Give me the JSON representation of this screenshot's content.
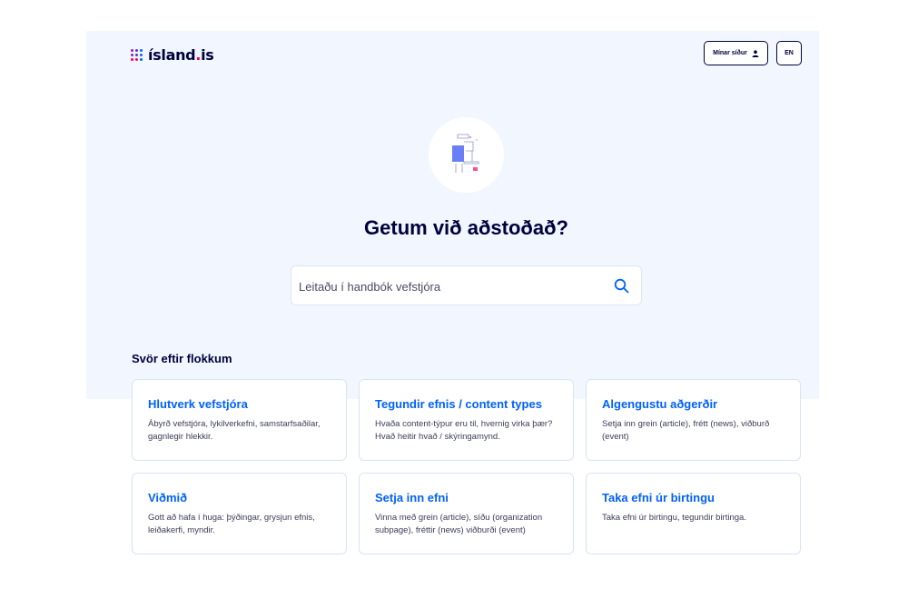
{
  "header": {
    "logo_text": "ísland",
    "logo_suffix": "is",
    "my_pages_label": "Mínar síður",
    "lang_label": "EN"
  },
  "hero": {
    "title": "Getum við aðstoðað?",
    "search_placeholder": "Leitaðu í handbók vefstjóra"
  },
  "categories": {
    "heading": "Svör eftir flokkum",
    "cards": [
      {
        "title": "Hlutverk vefstjóra",
        "desc": "Ábyrð vefstjóra, lykilverkefni, samstarfsaðilar, gagnlegir hlekkir."
      },
      {
        "title": "Tegundir efnis / content types",
        "desc": "Hvaða content-týpur eru til, hvernig virka þær? Hvað heitir hvað / skýringamynd."
      },
      {
        "title": "Algengustu aðgerðir",
        "desc": "Setja inn grein (article), frétt (news), viðburð (event)"
      },
      {
        "title": "Viðmið",
        "desc": "Gott að hafa í huga: þýðingar, grysjun efnis, leiðakerfi, myndir."
      },
      {
        "title": "Setja inn efni",
        "desc": "Vinna með grein (article), síðu (organization subpage), fréttir (news) viðburði (event)"
      },
      {
        "title": "Taka efni úr birtingu",
        "desc": "Taka efni úr birtingu, tegundir birtinga."
      }
    ]
  },
  "colors": {
    "brand_blue": "#0061ff",
    "dark": "#00003c",
    "hero_bg": "#f2f7ff"
  }
}
